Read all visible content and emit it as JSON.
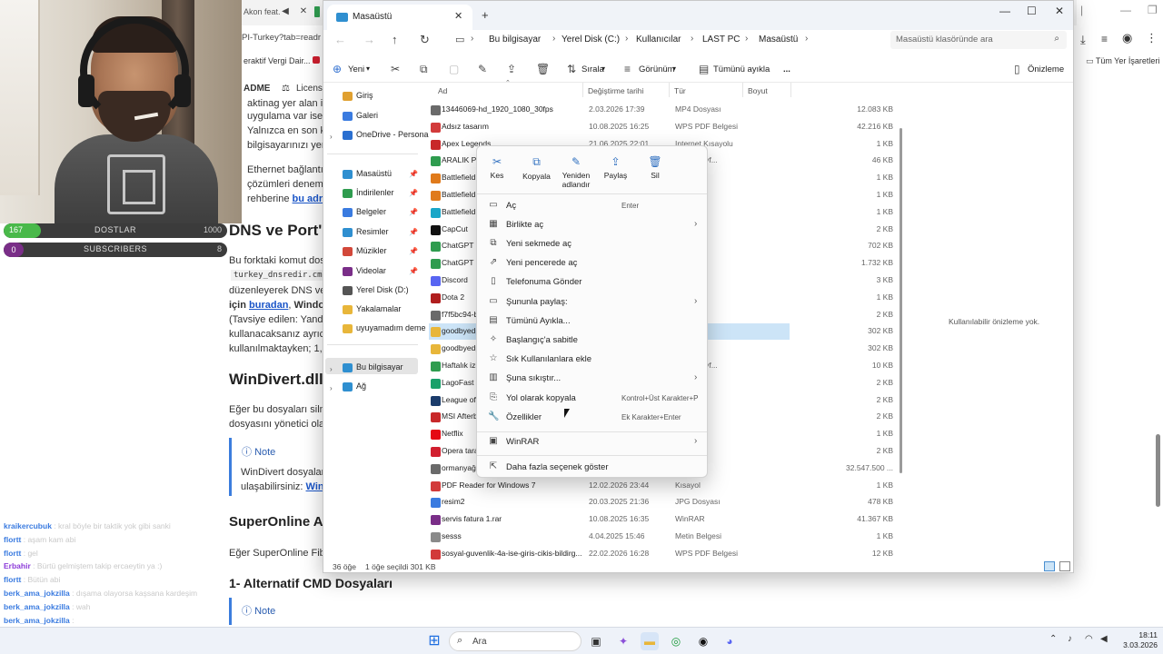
{
  "browser": {
    "tab_partial": "Akon feat.",
    "address_partial": "PI-Turkey?tab=readr",
    "favorites": [
      "eraktif Vergi Dair..."
    ],
    "favorites_right": "Tüm Yer İşaretleri",
    "nav_brand": "ADME",
    "nav_license": "License"
  },
  "article": {
    "lines": [
      "aktinag yer alan i",
      "uygulama var ise",
      "Yalnızca en son k",
      "bilgisayarınızı yer"
    ],
    "eth_1": "Ethernet bağlantı",
    "eth_2": "çözümleri denem",
    "eth_3": "rehberine",
    "eth_link": "bu adre",
    "h_dns": "DNS ve Port'u",
    "p1_1": "Bu forktaki komut dos",
    "p1_code": "turkey_dnsredir.cmd",
    "p1_3": "düzenleyerek DNS ve",
    "p1_4_a": "için",
    "p1_4_link": "buradan",
    "p1_4_b": "Window",
    "p1_5": "(Tavsiye edilen: Yandex",
    "p1_6": "kullanacaksanız ayrıca",
    "p1_7": "kullanılmaktayken; 1, 2",
    "h_windivert": "WinDivert.dll",
    "p2_1": "Eğer bu dosyaları silm",
    "p2_2": "dosyasını yönetici olar",
    "note_title": "Note",
    "note_1": "WinDivert dosyalar",
    "note_2_a": "ulaşabilirsiniz:",
    "note_2_link": "Win",
    "h_superonline": "SuperOnline A",
    "p3": "Eğer SuperOnline Fibe",
    "h_alt": "1- Alternatif CMD Dosyaları",
    "note2_title": "Note"
  },
  "stream": {
    "dostlar_left": "167",
    "dostlar_label": "DOSTLAR",
    "dostlar_right": "1000",
    "dostlar_progress": 0.167,
    "subs_left": "0",
    "subs_label": "SUBSCRIBERS",
    "subs_right": "8"
  },
  "chat": [
    {
      "user": "kraikercubuk",
      "msg": ": kral böyle bir taktik yok gibi sanki",
      "color": "#3a7be0"
    },
    {
      "user": "flortt",
      "msg": ": aşam kam abi",
      "color": "#3a7be0"
    },
    {
      "user": "flortt",
      "msg": ": gel",
      "color": "#3a7be0"
    },
    {
      "user": "Erbahir",
      "msg": ": Bürtü gelmiştem takip ercaeytin ya :)",
      "color": "#8c3bd9"
    },
    {
      "user": "flortt",
      "msg": ": Bütün abi",
      "color": "#3a7be0"
    },
    {
      "user": "berk_ama_jokzilla",
      "msg": ": dışama olayorsa kaşsana kardeşim",
      "color": "#3a7be0"
    },
    {
      "user": "berk_ama_jokzilla",
      "msg": ": wah",
      "color": "#3a7be0"
    },
    {
      "user": "berk_ama_jokzilla",
      "msg": ":",
      "color": "#3a7be0"
    }
  ],
  "explorer": {
    "tab_title": "Masaüstü",
    "breadcrumb": [
      "Bu bilgisayar",
      "Yerel Disk (C:)",
      "Kullanıcılar",
      "LAST PC",
      "Masaüstü"
    ],
    "search_placeholder": "Masaüstü klasöründe ara",
    "cmd": {
      "new": "Yeni",
      "sort": "Sırala",
      "view": "Görünüm",
      "select_all": "Tümünü ayıkla",
      "more": "...",
      "preview": "Önizleme"
    },
    "nav": {
      "home": "Giriş",
      "gallery": "Galeri",
      "onedrive": "OneDrive - Persona",
      "desktop": "Masaüstü",
      "downloads": "İndirilenler",
      "documents": "Belgeler",
      "pictures": "Resimler",
      "music": "Müzikler",
      "videos": "Videolar",
      "local_d": "Yerel Disk (D:)",
      "captures": "Yakalamalar",
      "uyuyamadim": "uyuyamadım deme",
      "this_pc": "Bu bilgisayar",
      "network": "Ağ"
    },
    "columns": {
      "name": "Ad",
      "date": "Değiştirme tarihi",
      "type": "Tür",
      "size": "Boyut"
    },
    "files": [
      {
        "name": "13446069-hd_1920_1080_30fps",
        "date": "2.03.2026 17:39",
        "type": "MP4 Dosyası",
        "size": "12.083 KB",
        "color": "#6a6a6a"
      },
      {
        "name": "Adsız tasarım",
        "date": "10.08.2025 16:25",
        "type": "WPS PDF Belgesi",
        "size": "42.216 KB",
        "color": "#d23a3a"
      },
      {
        "name": "Apex Legends",
        "date": "21.06.2025 22:01",
        "type": "Internet Kısayolu",
        "size": "1 KB",
        "color": "#c8282a"
      },
      {
        "name": "ARALIK PU",
        "date": "",
        "type": "ayola Sayf...",
        "size": "46 KB",
        "color": "#2f9c4f"
      },
      {
        "name": "Battlefield",
        "date": "",
        "type": "ayolu",
        "size": "1 KB",
        "color": "#e07a1b"
      },
      {
        "name": "Battlefield",
        "date": "",
        "type": "ayolu",
        "size": "1 KB",
        "color": "#e07a1b"
      },
      {
        "name": "Battlefield",
        "date": "",
        "type": "ayolu",
        "size": "1 KB",
        "color": "#1aa6c8"
      },
      {
        "name": "CapCut",
        "date": "",
        "type": "",
        "size": "2 KB",
        "color": "#111111"
      },
      {
        "name": "ChatGPT In",
        "date": "",
        "type": "",
        "size": "702 KB",
        "color": "#2f9c4f"
      },
      {
        "name": "ChatGPT In",
        "date": "",
        "type": "",
        "size": "1.732 KB",
        "color": "#2f9c4f"
      },
      {
        "name": "Discord",
        "date": "",
        "type": "",
        "size": "3 KB",
        "color": "#5865f2"
      },
      {
        "name": "Dota 2",
        "date": "",
        "type": "ayolu",
        "size": "1 KB",
        "color": "#b01e1e"
      },
      {
        "name": "f7f5bc94-b",
        "date": "",
        "type": "",
        "size": "2 KB",
        "color": "#6a6a6a"
      },
      {
        "name": "goodbyedp",
        "date": "",
        "type": "Klasör",
        "size": "302 KB",
        "color": "#e8b63a",
        "selected": true
      },
      {
        "name": "goodbyedp",
        "date": "",
        "type": "Klasör",
        "size": "302 KB",
        "color": "#e8b63a"
      },
      {
        "name": "Haftalık izi",
        "date": "",
        "type": "ayola Sayf...",
        "size": "10 KB",
        "color": "#2f9c4f"
      },
      {
        "name": "LagoFast",
        "date": "",
        "type": "",
        "size": "2 KB",
        "color": "#1aa06a"
      },
      {
        "name": "League of",
        "date": "",
        "type": "",
        "size": "2 KB",
        "color": "#1b3c6b"
      },
      {
        "name": "MSI Afterb",
        "date": "",
        "type": "",
        "size": "2 KB",
        "color": "#c8282a"
      },
      {
        "name": "Netflix",
        "date": "",
        "type": "",
        "size": "1 KB",
        "color": "#e50914"
      },
      {
        "name": "Opera tara",
        "date": "",
        "type": "",
        "size": "2 KB",
        "color": "#d11f2f"
      },
      {
        "name": "ormanyağı",
        "date": "",
        "type": "",
        "size": "32.547.500 ...",
        "color": "#6a6a6a"
      },
      {
        "name": "PDF Reader for Windows 7",
        "date": "12.02.2026 23:44",
        "type": "Kısayol",
        "size": "1 KB",
        "color": "#d23a3a"
      },
      {
        "name": "resim2",
        "date": "20.03.2025 21:36",
        "type": "JPG Dosyası",
        "size": "478 KB",
        "color": "#3a7be0"
      },
      {
        "name": "servis fatura 1.rar",
        "date": "10.08.2025 16:35",
        "type": "WinRAR",
        "size": "41.367 KB",
        "color": "#7a2e88"
      },
      {
        "name": "sesss",
        "date": "4.04.2025 15:46",
        "type": "Metin Belgesi",
        "size": "1 KB",
        "color": "#8a8a8a"
      },
      {
        "name": "sosyal-guvenlik-4a-ise-giris-cikis-bildirg...",
        "date": "22.02.2026 16:28",
        "type": "WPS PDF Belgesi",
        "size": "12 KB",
        "color": "#d23a3a"
      }
    ],
    "preview_text": "Kullanılabilir önizleme yok.",
    "status": {
      "count": "36 öğe",
      "selected": "1 öğe seçildi  301 KB"
    }
  },
  "context_menu": {
    "top": [
      {
        "label": "Kes",
        "icon": "scissors-icon",
        "glyph": "✂"
      },
      {
        "label": "Kopyala",
        "icon": "copy-icon",
        "glyph": "⧉"
      },
      {
        "label": "Yeniden adlandır",
        "icon": "rename-icon",
        "glyph": "✎"
      },
      {
        "label": "Paylaş",
        "icon": "share-icon",
        "glyph": "⇪"
      },
      {
        "label": "Sil",
        "icon": "trash-icon",
        "glyph": "🗑"
      }
    ],
    "items": [
      {
        "label": "Aç",
        "shortcut": "Enter",
        "icon": "folder-icon",
        "glyph": "▭",
        "arrow": false
      },
      {
        "label": "Birlikte aç",
        "shortcut": "",
        "icon": "open-with-icon",
        "glyph": "▦",
        "arrow": true
      },
      {
        "label": "Yeni sekmede aç",
        "shortcut": "",
        "icon": "new-tab-icon",
        "glyph": "⧉",
        "arrow": false
      },
      {
        "label": "Yeni pencerede aç",
        "shortcut": "",
        "icon": "new-window-icon",
        "glyph": "⇗",
        "arrow": false
      },
      {
        "label": "Telefonuma Gönder",
        "shortcut": "",
        "icon": "phone-icon",
        "glyph": "▯",
        "arrow": false
      },
      {
        "label": "Şununla paylaş:",
        "shortcut": "",
        "icon": "share-with-icon",
        "glyph": "▭",
        "arrow": true
      },
      {
        "label": "Tümünü Ayıkla...",
        "shortcut": "",
        "icon": "extract-icon",
        "glyph": "▤",
        "arrow": false
      },
      {
        "label": "Başlangıç'a sabitle",
        "shortcut": "",
        "icon": "pin-start-icon",
        "glyph": "✧",
        "arrow": false
      },
      {
        "label": "Sık Kullanılanlara ekle",
        "shortcut": "",
        "icon": "star-icon",
        "glyph": "☆",
        "arrow": false
      },
      {
        "label": "Şuna sıkıştır...",
        "shortcut": "",
        "icon": "compress-icon",
        "glyph": "▥",
        "arrow": true
      },
      {
        "label": "Yol olarak kopyala",
        "shortcut": "Kontrol+Üst Karakter+P",
        "icon": "copy-path-icon",
        "glyph": "⎘",
        "arrow": false
      },
      {
        "label": "Özellikler",
        "shortcut": "Ek Karakter+Enter",
        "icon": "properties-icon",
        "glyph": "🔧",
        "arrow": false
      },
      {
        "label": "WinRAR",
        "shortcut": "",
        "icon": "winrar-icon",
        "glyph": "▣",
        "arrow": true
      },
      {
        "label": "Daha fazla seçenek göster",
        "shortcut": "",
        "icon": "more-options-icon",
        "glyph": "⇱",
        "arrow": false
      }
    ]
  },
  "taskbar": {
    "search_label": "Ara",
    "time": "18:11",
    "date": "3.03.2026"
  }
}
